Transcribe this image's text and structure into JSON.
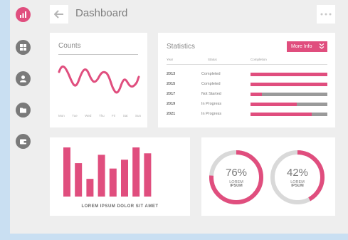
{
  "header": {
    "title": "Dashboard"
  },
  "sidebar": {
    "items": [
      {
        "icon": "bar-chart-icon",
        "active": true
      },
      {
        "icon": "grid-icon",
        "active": false
      },
      {
        "icon": "user-icon",
        "active": false
      },
      {
        "icon": "folder-icon",
        "active": false
      },
      {
        "icon": "wallet-icon",
        "active": false
      }
    ]
  },
  "counts": {
    "title": "Counts",
    "days": [
      "Mon",
      "Tue",
      "Wed",
      "Thu",
      "Fri",
      "Sat",
      "Sun"
    ]
  },
  "statistics": {
    "title": "Statistics",
    "button_label": "More Info",
    "columns": [
      "Year",
      "Status",
      "Completion"
    ],
    "rows": [
      {
        "year": "2013",
        "status": "Completed",
        "completion": 1.0
      },
      {
        "year": "2015",
        "status": "Completed",
        "completion": 1.0
      },
      {
        "year": "2017",
        "status": "Not Started",
        "completion": 0.15
      },
      {
        "year": "2019",
        "status": "In Progress",
        "completion": 0.6
      },
      {
        "year": "2021",
        "status": "In Progress",
        "completion": 0.8
      }
    ]
  },
  "bars": {
    "caption": "LOREM IPSUM DOLOR SIT AMET",
    "values": [
      100,
      68,
      36,
      85,
      57,
      75,
      100,
      88
    ]
  },
  "donuts": [
    {
      "percent_label": "76%",
      "value": 0.76,
      "sub1": "LOREM",
      "sub2": "IPSUM"
    },
    {
      "percent_label": "42%",
      "value": 0.42,
      "sub1": "LOREM",
      "sub2": "IPSUM"
    }
  ],
  "colors": {
    "accent": "#e04e7e",
    "track": "#d9d9d9",
    "bar_bg": "#9a9a9a"
  }
}
